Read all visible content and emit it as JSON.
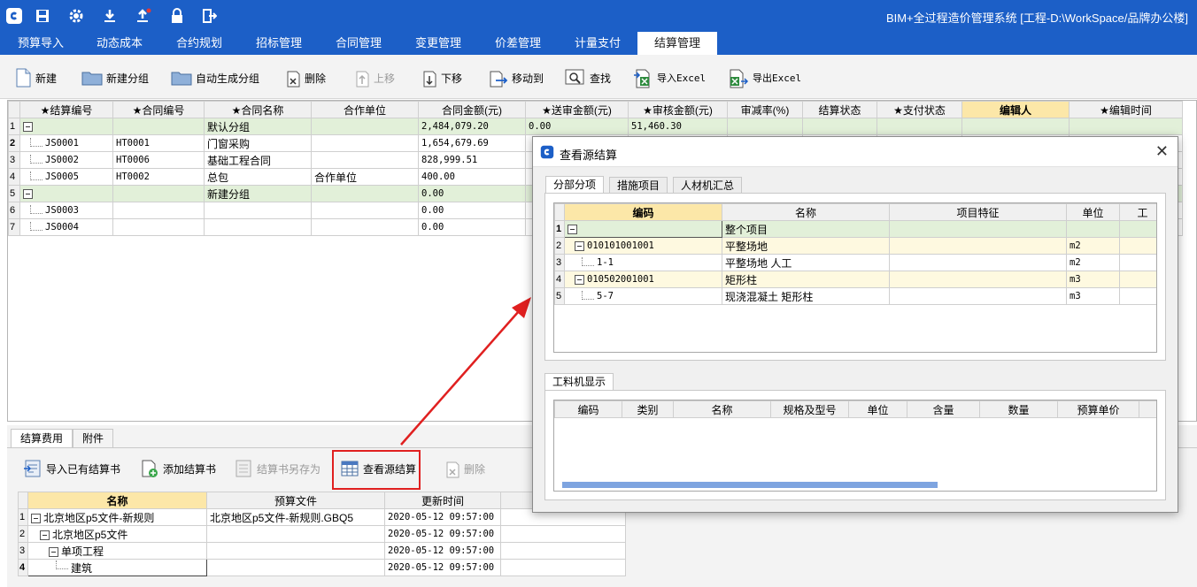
{
  "app": {
    "title": "BIM+全过程造价管理系统 [工程-D:\\WorkSpace/品牌办公楼]",
    "accent": "#1c5fc7"
  },
  "quick_access": [
    {
      "name": "app-logo-icon"
    },
    {
      "name": "save-icon"
    },
    {
      "name": "gear-icon"
    },
    {
      "name": "download-icon"
    },
    {
      "name": "upload-icon"
    },
    {
      "name": "lock-icon"
    },
    {
      "name": "exit-icon"
    }
  ],
  "menu_tabs": [
    "预算导入",
    "动态成本",
    "合约规划",
    "招标管理",
    "合同管理",
    "变更管理",
    "价差管理",
    "计量支付",
    "结算管理"
  ],
  "toolbar": {
    "new": "新建",
    "new_group": "新建分组",
    "auto_group": "自动生成分组",
    "delete": "删除",
    "move_up": "上移",
    "move_down": "下移",
    "move_to": "移动到",
    "find": "查找",
    "import_excel": "导入Excel",
    "export_excel": "导出Excel"
  },
  "main_grid": {
    "headers": [
      "★结算编号",
      "★合同编号",
      "★合同名称",
      "合作单位",
      "合同金额(元)",
      "★送审金额(元)",
      "★审核金额(元)",
      "审减率(%)",
      "结算状态",
      "★支付状态",
      "编辑人",
      "★编辑时间"
    ],
    "rows": [
      {
        "num": "1",
        "type": "group",
        "name": "默认分组",
        "amount": "2,484,079.20",
        "submit": "0.00",
        "audit": "51,460.30"
      },
      {
        "num": "2",
        "type": "item",
        "code": "JS0001",
        "contract": "HT0001",
        "name": "门窗采购",
        "partner": "",
        "amount": "1,654,679.69"
      },
      {
        "num": "3",
        "type": "item",
        "code": "JS0002",
        "contract": "HT0006",
        "name": "基础工程合同",
        "partner": "",
        "amount": "828,999.51"
      },
      {
        "num": "4",
        "type": "item",
        "code": "JS0005",
        "contract": "HT0002",
        "name": "总包",
        "partner": "合作单位",
        "amount": "400.00"
      },
      {
        "num": "5",
        "type": "group",
        "name": "新建分组",
        "amount": "0.00"
      },
      {
        "num": "6",
        "type": "item",
        "code": "JS0003",
        "contract": "",
        "name": "",
        "partner": "",
        "amount": "0.00"
      },
      {
        "num": "7",
        "type": "item",
        "code": "JS0004",
        "contract": "",
        "name": "",
        "partner": "",
        "amount": "0.00"
      }
    ]
  },
  "bottom_tabs": [
    "结算费用",
    "附件"
  ],
  "bottom_toolbar": {
    "import_existing": "导入已有结算书",
    "add_book": "添加结算书",
    "save_as": "结算书另存为",
    "view_source": "查看源结算",
    "delete": "删除"
  },
  "bottom_grid": {
    "headers": [
      "名称",
      "预算文件",
      "更新时间"
    ],
    "rows": [
      {
        "num": "1",
        "name": "北京地区p5文件-新规则",
        "file": "北京地区p5文件-新规则.GBQ5",
        "time": "2020-05-12 09:57:00"
      },
      {
        "num": "2",
        "name": "北京地区p5文件",
        "file": "",
        "time": "2020-05-12 09:57:00"
      },
      {
        "num": "3",
        "name": "单项工程",
        "file": "",
        "time": "2020-05-12 09:57:00"
      },
      {
        "num": "4",
        "name": "建筑",
        "file": "",
        "time": "2020-05-12 09:57:00"
      }
    ]
  },
  "dialog": {
    "title": "查看源结算",
    "tabs": [
      "分部分项",
      "措施项目",
      "人材机汇总"
    ],
    "grid": {
      "headers": [
        "编码",
        "名称",
        "项目特征",
        "单位",
        "工"
      ],
      "rows": [
        {
          "num": "1",
          "code": "",
          "name": "整个项目",
          "unit": "",
          "kind": "group"
        },
        {
          "num": "2",
          "code": "010101001001",
          "name": "平整场地",
          "unit": "m2",
          "kind": "yellow"
        },
        {
          "num": "3",
          "code": "1-1",
          "name": "平整场地 人工",
          "unit": "m2",
          "kind": "plain"
        },
        {
          "num": "4",
          "code": "010502001001",
          "name": "矩形柱",
          "unit": "m3",
          "kind": "yellow"
        },
        {
          "num": "5",
          "code": "5-7",
          "name": "现浇混凝土 矩形柱",
          "unit": "m3",
          "kind": "plain"
        }
      ]
    },
    "material_tab": "工料机显示",
    "material_headers": [
      "编码",
      "类别",
      "名称",
      "规格及型号",
      "单位",
      "含量",
      "数量",
      "预算单价"
    ]
  }
}
